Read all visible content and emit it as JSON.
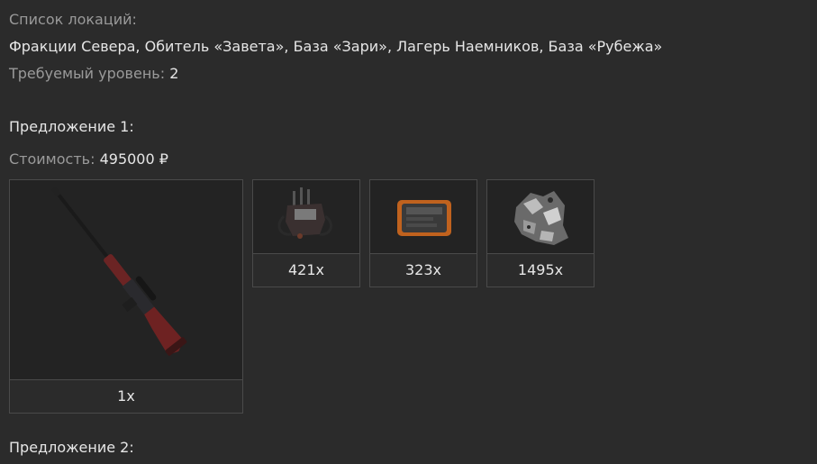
{
  "locations": {
    "label": "Список локаций:",
    "list": "Фракции Севера, Обитель «Завета», База «Зари», Лагерь Наемников, База «Рубежа»"
  },
  "level": {
    "label": "Требуемый уровень:",
    "value": "2"
  },
  "offers": [
    {
      "title": "Предложение 1:",
      "cost_label": "Стоимость:",
      "cost_value": "495000 ₽",
      "reward": {
        "icon": "sniper-rifle-icon",
        "qty": "1x"
      },
      "items": [
        {
          "icon": "electronic-device-icon",
          "qty": "421x"
        },
        {
          "icon": "orange-case-icon",
          "qty": "323x"
        },
        {
          "icon": "rock-ore-icon",
          "qty": "1495x"
        }
      ]
    },
    {
      "title": "Предложение 2:"
    }
  ]
}
